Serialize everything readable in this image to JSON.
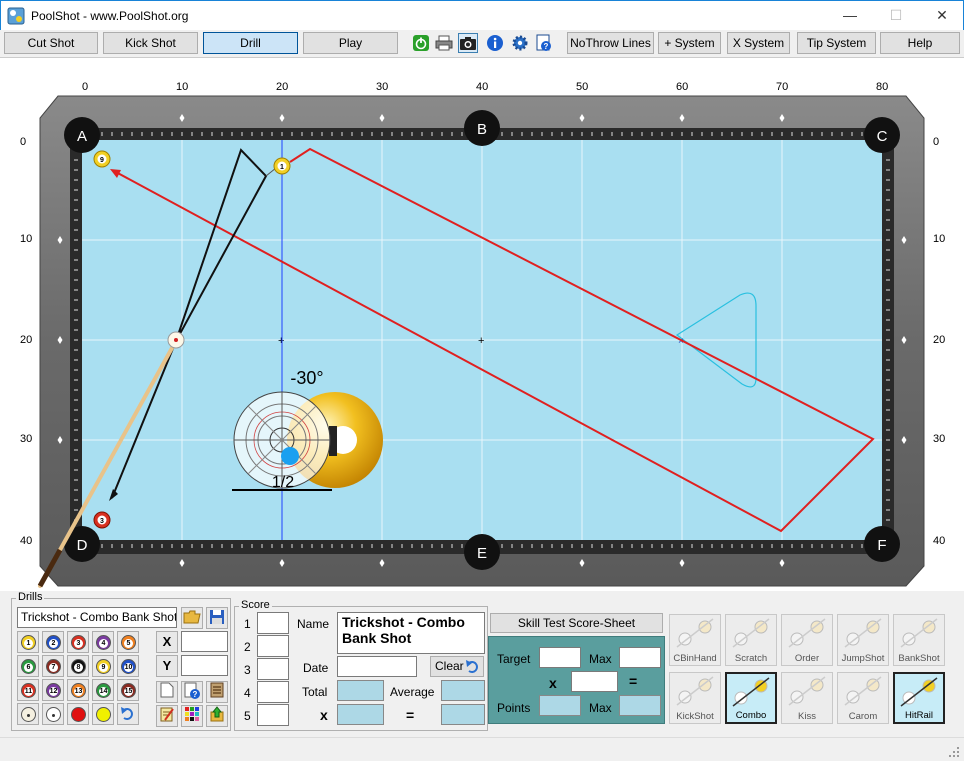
{
  "window": {
    "title": "PoolShot - www.PoolShot.org",
    "minimize": "—",
    "maximize": "☐",
    "close": "✕"
  },
  "toolbar": {
    "buttons": [
      "Cut Shot",
      "Kick Shot",
      "Drill",
      "Play"
    ],
    "active": "Drill",
    "icons": [
      "power-icon",
      "printer-icon",
      "camera-icon",
      "info-icon",
      "gear-icon",
      "help-document-icon"
    ],
    "right_buttons": [
      "NoThrow Lines",
      "+ System",
      "X System",
      "Tip System",
      "Help"
    ]
  },
  "table": {
    "x_ticks": [
      "0",
      "10",
      "20",
      "30",
      "40",
      "50",
      "60",
      "70",
      "80"
    ],
    "y_ticks": [
      "0",
      "10",
      "20",
      "30",
      "40"
    ],
    "pockets": [
      "A",
      "B",
      "C",
      "D",
      "E",
      "F"
    ],
    "balls": [
      {
        "number": "9",
        "color": "#f2d024",
        "pos": [
          2,
          2
        ]
      },
      {
        "number": "1",
        "color": "#f2d024",
        "pos": [
          20,
          2.5
        ]
      },
      {
        "number": "3",
        "color": "#d83020",
        "pos": [
          2,
          38
        ]
      },
      {
        "number": "cue",
        "color": "#ffffff",
        "pos": [
          9.5,
          20
        ]
      }
    ],
    "aim_angle": "-30°",
    "ball_fraction": "1/2",
    "colors": {
      "cloth": "#a9dff1",
      "rail": "#6e6e6e",
      "shot_line": "#e02020",
      "cue_path": "#111111",
      "rack": "#29c0e0",
      "aim_line": "#2040ff"
    }
  },
  "drills_panel": {
    "label": "Drills",
    "drill_name": "Trickshot - Combo Bank Shot",
    "x_label": "X",
    "y_label": "Y",
    "x_value": "",
    "y_value": "",
    "ball_rows": [
      [
        {
          "n": "1",
          "c": "#f2d024"
        },
        {
          "n": "2",
          "c": "#2050c8"
        },
        {
          "n": "3",
          "c": "#d83020"
        },
        {
          "n": "4",
          "c": "#7a3aa0"
        },
        {
          "n": "5",
          "c": "#f08020"
        }
      ],
      [
        {
          "n": "6",
          "c": "#2a9a40"
        },
        {
          "n": "7",
          "c": "#8a2a20"
        },
        {
          "n": "8",
          "c": "#111111"
        },
        {
          "n": "9",
          "c": "#f2d024"
        },
        {
          "n": "10",
          "c": "#2050c8"
        }
      ],
      [
        {
          "n": "11",
          "c": "#d83020"
        },
        {
          "n": "12",
          "c": "#7a3aa0"
        },
        {
          "n": "13",
          "c": "#f08020"
        },
        {
          "n": "14",
          "c": "#2a9a40"
        },
        {
          "n": "15",
          "c": "#8a2a20"
        }
      ],
      [
        {
          "n": "",
          "c": "#f5f0e0"
        },
        {
          "n": "",
          "c": "#ffffff"
        },
        {
          "n": "",
          "c": "#e01010"
        },
        {
          "n": "",
          "c": "#f0f000"
        },
        {
          "n": "",
          "c": "undo"
        }
      ]
    ]
  },
  "score_panel": {
    "label": "Score",
    "rows": [
      "1",
      "2",
      "3",
      "4",
      "5"
    ],
    "name_label": "Name",
    "name_value": "Trickshot - Combo Bank Shot",
    "date_label": "Date",
    "date_value": "",
    "clear_label": "Clear",
    "total_label": "Total",
    "average_label": "Average",
    "x_label": "x",
    "eq_label": "="
  },
  "skill_test": {
    "button": "Skill Test Score-Sheet",
    "target_label": "Target",
    "max_label": "Max",
    "x_label": "x",
    "eq_label": "=",
    "points_label": "Points",
    "max2_label": "Max"
  },
  "drill_types": [
    {
      "label": "CBinHand",
      "selected": false
    },
    {
      "label": "Scratch",
      "selected": false
    },
    {
      "label": "Order",
      "selected": false
    },
    {
      "label": "JumpShot",
      "selected": false
    },
    {
      "label": "BankShot",
      "selected": false
    },
    {
      "label": "KickShot",
      "selected": false
    },
    {
      "label": "Combo",
      "selected": true
    },
    {
      "label": "Kiss",
      "selected": false
    },
    {
      "label": "Carom",
      "selected": false
    },
    {
      "label": "HitRail",
      "selected": true
    }
  ]
}
